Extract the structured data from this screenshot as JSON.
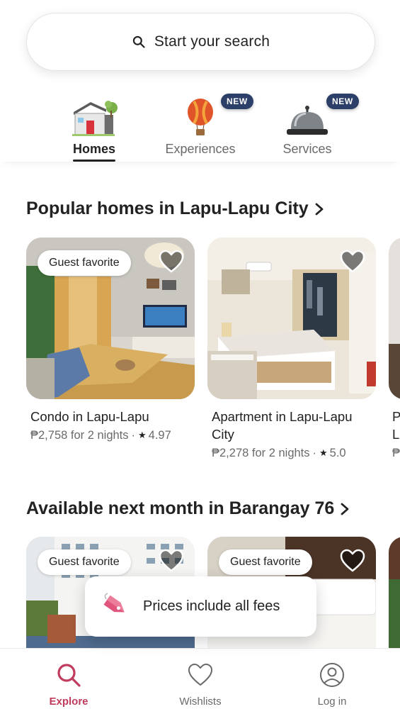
{
  "search": {
    "label": "Start your search"
  },
  "tabs": [
    {
      "label": "Homes",
      "active": true,
      "badge": ""
    },
    {
      "label": "Experiences",
      "active": false,
      "badge": "NEW"
    },
    {
      "label": "Services",
      "active": false,
      "badge": "NEW"
    }
  ],
  "sections": [
    {
      "title": "Popular homes in Lapu-Lapu City",
      "cards": [
        {
          "badge": "Guest favorite",
          "title": "Condo in Lapu-Lapu",
          "price": "₱2,758 for 2 nights",
          "rating": "4.97"
        },
        {
          "badge": "",
          "title": "Apartment in Lapu-Lapu City",
          "price": "₱2,278 for 2 nights",
          "rating": "5.0"
        },
        {
          "title_partial": "P",
          "title_partial_2": "L",
          "price_partial": "₱"
        }
      ]
    },
    {
      "title": "Available next month in Barangay 76",
      "cards": [
        {
          "badge": "Guest favorite"
        },
        {
          "badge": "Guest favorite"
        }
      ]
    }
  ],
  "toast": {
    "text": "Prices include all fees"
  },
  "bottom_nav": [
    {
      "label": "Explore",
      "active": true,
      "icon": "search-icon"
    },
    {
      "label": "Wishlists",
      "active": false,
      "icon": "heart-icon"
    },
    {
      "label": "Log in",
      "active": false,
      "icon": "profile-icon"
    }
  ],
  "colors": {
    "accent": "#c13b5d",
    "badge_navy": "#2b3f68",
    "text_primary": "#222222",
    "text_secondary": "#6a6a6a"
  }
}
